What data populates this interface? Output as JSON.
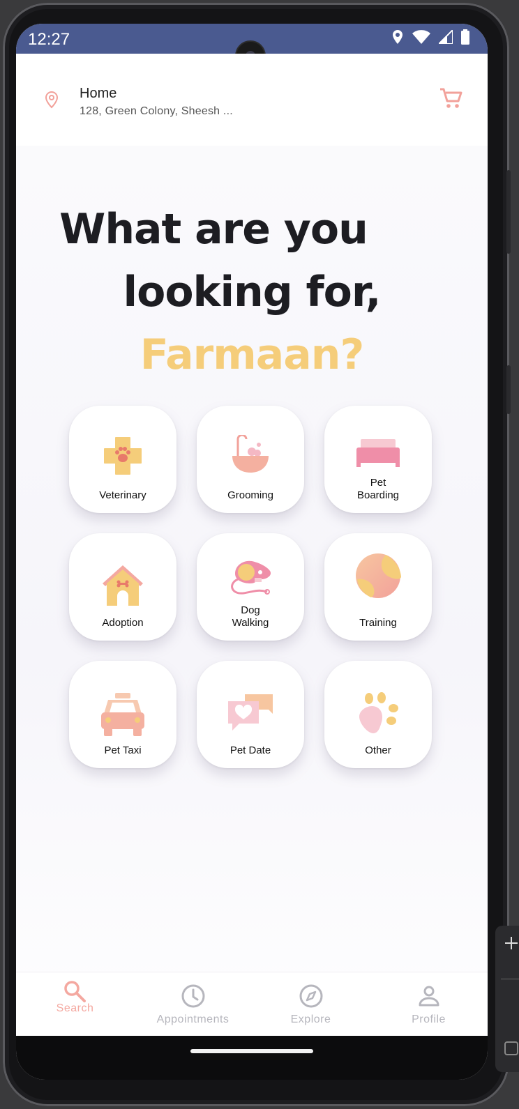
{
  "status_bar": {
    "time": "12:27",
    "icons": [
      "location-icon",
      "wifi-icon",
      "signal-icon",
      "battery-icon"
    ]
  },
  "header": {
    "location_title": "Home",
    "location_address": "128, Green Colony, Sheesh ...",
    "icons": {
      "location": "location-pin-icon",
      "cart": "cart-icon"
    }
  },
  "headline": {
    "line1": "What are you",
    "line2": "looking for, ",
    "name": "Farmaan?"
  },
  "services": [
    {
      "label": "Veterinary",
      "icon": "veterinary-icon"
    },
    {
      "label": "Grooming",
      "icon": "grooming-icon"
    },
    {
      "label": "Pet\nBoarding",
      "icon": "bed-icon"
    },
    {
      "label": "Adoption",
      "icon": "dog-house-icon"
    },
    {
      "label": "Dog\nWalking",
      "icon": "leash-icon"
    },
    {
      "label": "Training",
      "icon": "tennis-ball-icon"
    },
    {
      "label": "Pet Taxi",
      "icon": "taxi-icon"
    },
    {
      "label": "Pet Date",
      "icon": "chat-heart-icon"
    },
    {
      "label": "Other",
      "icon": "paw-icon"
    }
  ],
  "bottom_nav": [
    {
      "label": "Search",
      "icon": "search-icon",
      "active": true
    },
    {
      "label": "Appointments",
      "icon": "clock-icon",
      "active": false
    },
    {
      "label": "Explore",
      "icon": "compass-icon",
      "active": false
    },
    {
      "label": "Profile",
      "icon": "profile-icon",
      "active": false
    }
  ],
  "colors": {
    "status_bar": "#4a5a90",
    "accent_pink": "#f4a8a0",
    "accent_yellow": "#f5cd7a",
    "headline": "#1d1d22"
  }
}
